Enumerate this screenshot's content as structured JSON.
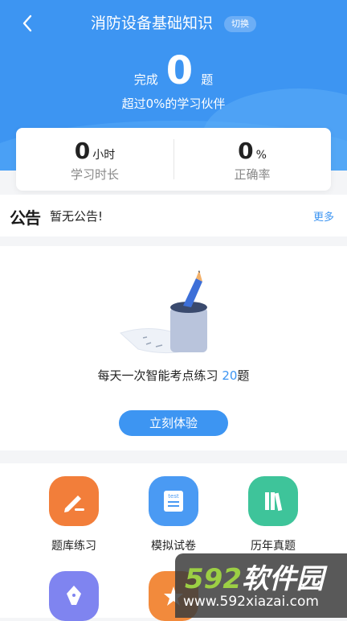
{
  "header": {
    "title": "消防设备基础知识",
    "switch_label": "切换",
    "done_prefix": "完成",
    "done_count": "0",
    "done_suffix": "题",
    "exceed_text": "超过0%的学习伙伴"
  },
  "stats": {
    "hours_value": "0",
    "hours_unit": "小时",
    "hours_caption": "学习时长",
    "accuracy_value": "0",
    "accuracy_unit": "%",
    "accuracy_caption": "正确率"
  },
  "notice": {
    "badge": "公告",
    "text": "暂无公告!",
    "more": "更多"
  },
  "practice": {
    "line_prefix": "每天一次智能考点练习 ",
    "count": "20",
    "line_suffix": "题",
    "button": "立刻体验"
  },
  "grid": {
    "items": [
      {
        "label": "题库练习",
        "icon": "pencil-icon",
        "color": "#f27e3a"
      },
      {
        "label": "模拟试卷",
        "icon": "test-paper-icon",
        "color": "#4a9af3"
      },
      {
        "label": "历年真题",
        "icon": "books-icon",
        "color": "#3ec49a"
      },
      {
        "label": "",
        "icon": "fountain-pen-icon",
        "color": "#7f84f0"
      },
      {
        "label": "",
        "icon": "star-icon",
        "color": "#f28a3c"
      }
    ]
  },
  "watermark": {
    "brand_num": "592",
    "brand_text": "软件园",
    "url": "www.592xiazai.com"
  },
  "colors": {
    "primary": "#3d95f2"
  }
}
